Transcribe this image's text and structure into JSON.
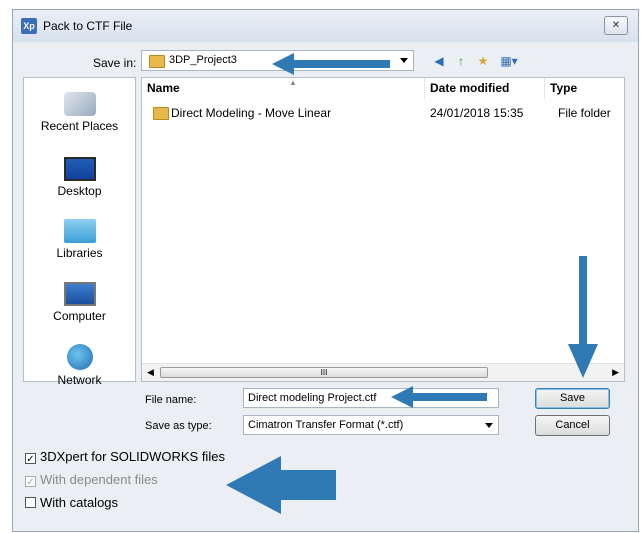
{
  "window": {
    "title": "Pack to CTF File",
    "app_icon": "Xp",
    "close": "✕"
  },
  "savein": {
    "label": "Save in:",
    "value": "3DP_Project3"
  },
  "toolbar": {
    "back_icon": "◀",
    "up_icon": "↑",
    "newfolder_icon": "★",
    "views_icon": "▦▾"
  },
  "places": [
    {
      "label": "Recent Places",
      "icon": "recent-places-icon"
    },
    {
      "label": "Desktop",
      "icon": "desktop-icon"
    },
    {
      "label": "Libraries",
      "icon": "libraries-icon"
    },
    {
      "label": "Computer",
      "icon": "computer-icon"
    },
    {
      "label": "Network",
      "icon": "network-icon"
    }
  ],
  "filelist": {
    "columns": [
      "Name",
      "Date modified",
      "Type"
    ],
    "rows": [
      {
        "name": "Direct Modeling - Move Linear",
        "date": "24/01/2018 15:35",
        "type": "File folder"
      }
    ],
    "scroll_thumb": "III"
  },
  "filename": {
    "label": "File name:",
    "value": "Direct modeling Project.ctf"
  },
  "savetype": {
    "label": "Save as type:",
    "value": "Cimatron Transfer Format (*.ctf)"
  },
  "buttons": {
    "save": "Save",
    "cancel": "Cancel"
  },
  "options": [
    {
      "label": "3DXpert for SOLIDWORKS files",
      "checked": true,
      "enabled": true
    },
    {
      "label": "With dependent files",
      "checked": true,
      "enabled": false
    },
    {
      "label": "With catalogs",
      "checked": false,
      "enabled": true
    }
  ],
  "colors": {
    "arrow": "#2f79b4",
    "dialog_bg": "#ebeef3"
  }
}
